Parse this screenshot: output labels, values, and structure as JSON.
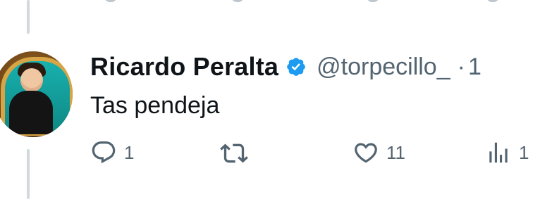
{
  "tweet": {
    "author": {
      "display_name": "Ricardo Peralta",
      "handle": "@torpecillo_",
      "verified": true
    },
    "separator": "·",
    "time_partial": "1",
    "text": "Tas pendeja"
  },
  "actions": {
    "reply": {
      "count": "1",
      "icon": "reply-icon"
    },
    "retweet": {
      "count": "",
      "icon": "retweet-icon"
    },
    "like": {
      "count": "11",
      "icon": "heart-icon"
    },
    "views": {
      "count": "1",
      "icon": "analytics-icon"
    }
  },
  "colors": {
    "text_primary": "#0f1419",
    "text_secondary": "#536471",
    "verified_blue": "#1d9bf0",
    "thread_line": "#cfd9de"
  }
}
